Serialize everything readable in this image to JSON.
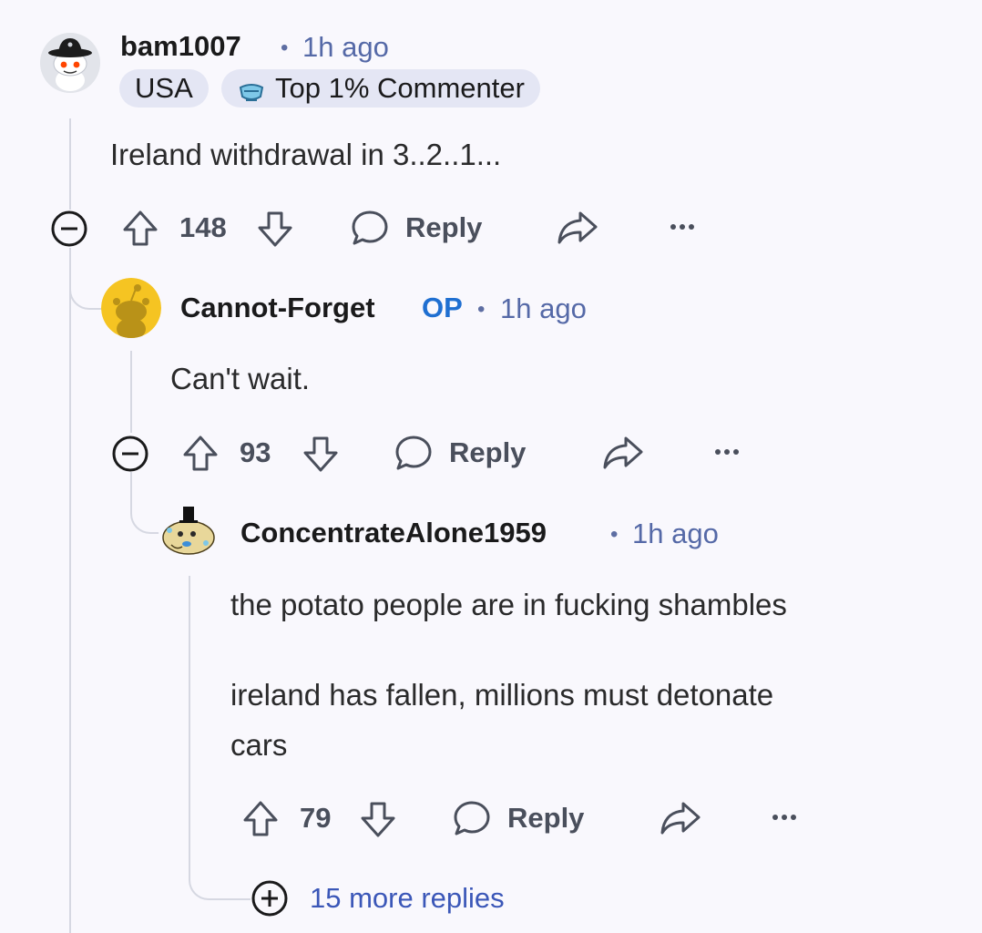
{
  "comments": [
    {
      "username": "bam1007",
      "time": "1h ago",
      "flairs": [
        "USA",
        "Top 1% Commenter"
      ],
      "body": [
        "Ireland withdrawal in 3..2..1..."
      ],
      "votes": "148",
      "reply_label": "Reply",
      "avatar_icon": "snoo-cowboy-avatar"
    },
    {
      "username": "Cannot-Forget",
      "op_label": "OP",
      "time": "1h ago",
      "body": [
        "Can't wait."
      ],
      "votes": "93",
      "reply_label": "Reply",
      "avatar_icon": "snoo-default-yellow-avatar"
    },
    {
      "username": "ConcentrateAlone1959",
      "time": "1h ago",
      "body": [
        "the potato people are in fucking shambles",
        "ireland has fallen, millions must detonate",
        "cars"
      ],
      "votes": "79",
      "reply_label": "Reply",
      "avatar_icon": "potato-top-hat-avatar"
    }
  ],
  "more_replies": "15 more replies",
  "colors": {
    "background": "#f9f8fd",
    "thread_line": "#d6d8e2",
    "time": "#5569a7",
    "op": "#1f6fd1",
    "link": "#3b57b8",
    "flair_bg": "#e4e6f4"
  }
}
